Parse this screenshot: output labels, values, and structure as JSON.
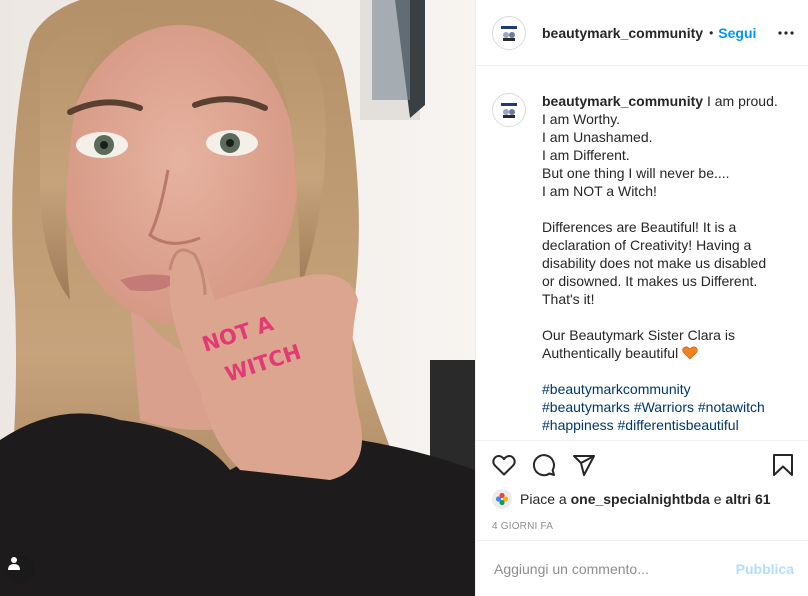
{
  "post": {
    "username": "beautymark_community",
    "follow_label": "Segui",
    "separator": "•",
    "caption_lines": [
      "I am Worthy.",
      "I am Unashamed.",
      "I am Different.",
      "But one thing I will never be....",
      "I am NOT a Witch!",
      "",
      "Differences are Beautiful! It is a",
      "declaration of Creativity! Having a",
      "disability does not make us disabled",
      "or disowned. It makes us Different.",
      "That's it!",
      "",
      "Our Beautymark Sister Clara is"
    ],
    "caption_first_line": "I am proud.",
    "caption_last_line": "Authentically beautiful",
    "heart_emoji_color": "#f77f1e",
    "hashtags": [
      "#beautymarkcommunity",
      "#beautymarks",
      "#Warriors",
      "#notawitch",
      "#happiness",
      "#differentisbeautiful"
    ],
    "likes": {
      "prefix": "Piace a",
      "user": "one_specialnightbda",
      "joiner": "e",
      "others": "altri 61"
    },
    "timestamp": "4 GIORNI FA",
    "comment_placeholder": "Aggiungi un commento...",
    "publish_label": "Pubblica",
    "hand_writing": "NOT A WITCH"
  },
  "colors": {
    "link_blue": "#0095f6",
    "hashtag_blue": "#00376b",
    "publish_disabled": "#b2dffc",
    "meta_grey": "#8e8e8e",
    "divider": "#efefef"
  },
  "icons": [
    "user-tag-icon",
    "more-options-icon",
    "heart-icon",
    "comment-icon",
    "share-icon",
    "bookmark-icon"
  ]
}
